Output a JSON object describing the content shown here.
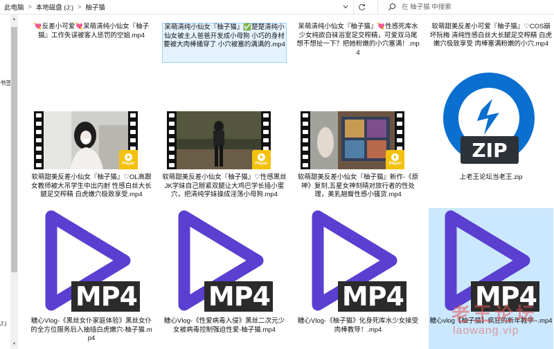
{
  "address_bar": {
    "crumbs": [
      "此电脑",
      "本地磁盘 (J:)",
      "柚子猫"
    ],
    "separator": ">"
  },
  "search": {
    "placeholder": "在 柚子猫 中搜索"
  },
  "nav_pane": {
    "labels": [
      "书签",
      "J:)"
    ]
  },
  "badge_text": "Player",
  "files": [
    {
      "name": "💘反差小可爱💘呆萌清纯小仙女『柚子猫』工作失误被客人惩罚的空姐.mp4",
      "thumb": "none"
    },
    {
      "name": "呆萌清纯小仙女『柚子猫』✅楚楚清纯小仙女被主人爸爸开发成小母狗 小巧的身材要被大肉棒捅穿了 小穴被塞的满满的.mp4",
      "thumb": "none"
    },
    {
      "name": "呆萌清纯小仙女『柚子猫』💘性感死库水少女纯欲白袜浴室足交榨精，可爱双马尾想不想扯一下？把她粉嫩的小穴塞满！.mp4",
      "thumb": "none"
    },
    {
      "name": "软萌甜美反差小可爱『柚子猫』♡COS崩坏阮梅 清纯性感白丝大长腿足交榨精 白虎嫩穴极致享受 肉棒塞满粉嫩的小穴.mp4",
      "thumb": "none"
    },
    {
      "name": "软萌甜美反差小仙女『柚子猫』♡OL高跟女教师被大吊学生中出内射 性感白丝大长腿足交榨精 白虎嫩穴极致享受.mp4",
      "thumb": "film"
    },
    {
      "name": "软萌甜美反差小仙女『柚子猫』♡性感黑丝JK学妹自己掰紧双腿让大鸡巴学长插小蜜穴，把清纯学妹操成淫荡小母狗.mp4",
      "thumb": "film"
    },
    {
      "name": "软萌甜美反差小仙女『柚子猫』新作-《原神》复刻,五星女神刻晴对旅行者的性处理，美乳翘臀性感小骚货.mp4",
      "thumb": "film"
    },
    {
      "name": "上老王论坛当老王.zip",
      "thumb": "zip"
    },
    {
      "name": "糖心Vlog-《黑丝女仆家庭体验》黑丝女仆的全方位服务后入抽插白虎嫩穴-柚子猫.mp4",
      "thumb": "mp4"
    },
    {
      "name": "糖心Vlog-《性爱病毒入侵》黑丝二次元少女被病毒控制强迫性爱-柚子猫.mp4",
      "thumb": "mp4"
    },
    {
      "name": "糖心Vlog-《柚子猫》化身死库水少女接受肉棒教导！.mp4",
      "thumb": "mp4"
    },
    {
      "name": "糖心vlog【柚子猫】疯狂的新年教学~.mp4",
      "thumb": "mp4"
    }
  ],
  "icon_labels": {
    "zip": "ZIP",
    "mp4": "MP4"
  },
  "colors": {
    "mp4_purple": "#5a3fd0",
    "zip_blue": "#0078d7",
    "badge_yellow": "#f4c20d",
    "selection": "#cce8ff"
  },
  "watermark": {
    "line1": "老王论坛",
    "line2": "laowang.vip"
  }
}
